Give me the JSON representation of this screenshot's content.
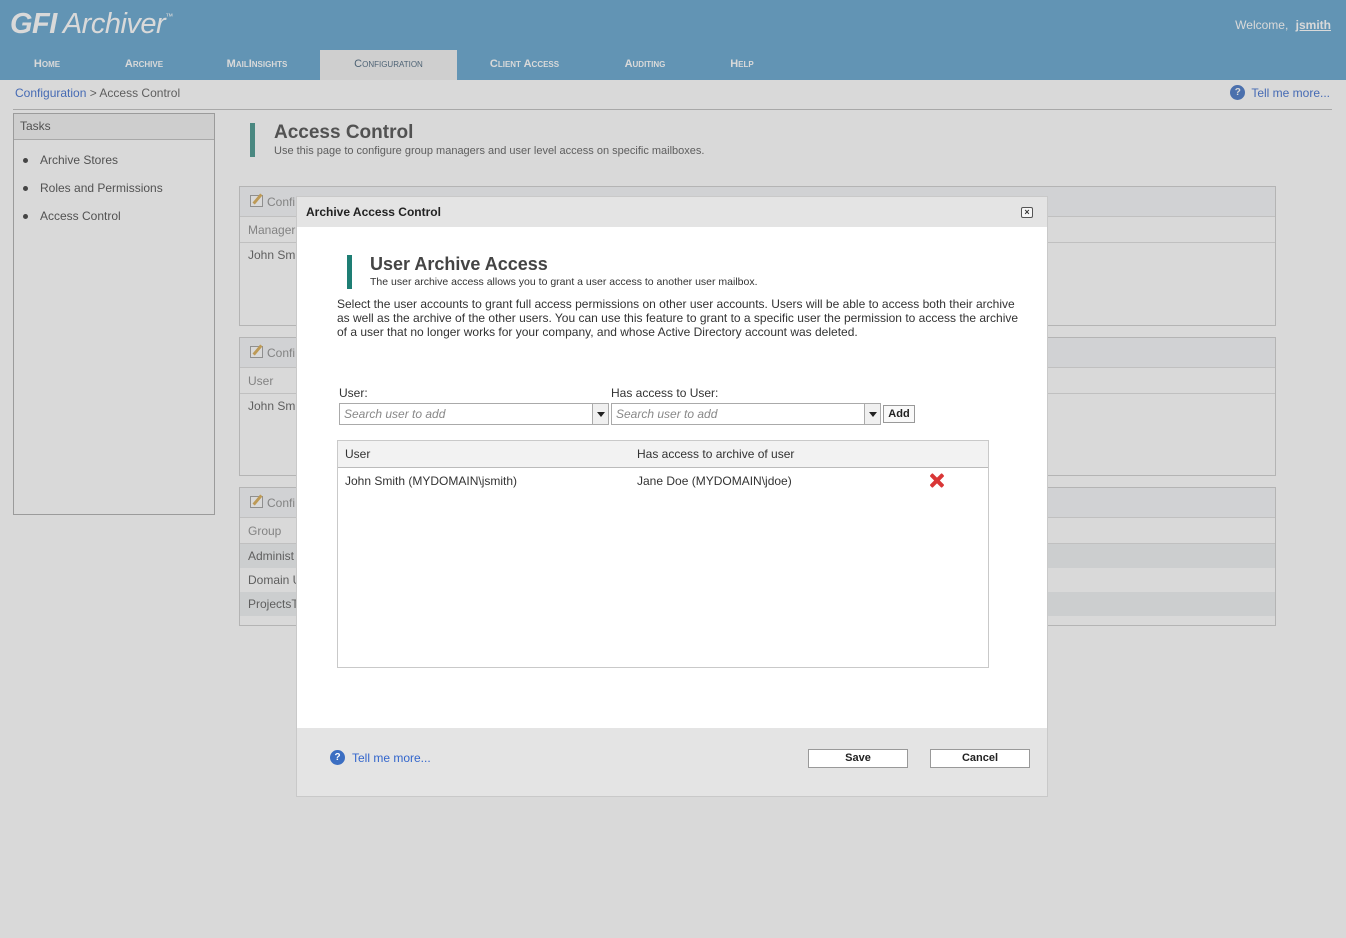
{
  "app": {
    "logo_bold": "GFI",
    "logo_text": "Archiver",
    "logo_tm": "™",
    "welcome_label": "Welcome,",
    "username": "jsmith"
  },
  "nav": {
    "items": [
      {
        "label": "Home"
      },
      {
        "label": "Archive"
      },
      {
        "label": "MailInsights"
      },
      {
        "label": "Configuration"
      },
      {
        "label": "Client Access"
      },
      {
        "label": "Auditing"
      },
      {
        "label": "Help"
      }
    ],
    "active": "Configuration"
  },
  "breadcrumb": {
    "root": "Configuration",
    "sep": ">",
    "current": "Access Control"
  },
  "help": {
    "label": "Tell me more..."
  },
  "tasks": {
    "title": "Tasks",
    "items": [
      "Archive Stores",
      "Roles and Permissions",
      "Access Control"
    ]
  },
  "page": {
    "title": "Access Control",
    "subtitle": "Use this page to configure group managers and user level access on specific mailboxes."
  },
  "panels": [
    {
      "head": "Confi",
      "col": "Manager",
      "rows": [
        "John Smi"
      ]
    },
    {
      "head": "Confi",
      "col": "User",
      "rows": [
        "John Smi"
      ]
    },
    {
      "head": "Confi",
      "col": "Group",
      "rows": [
        "Administ",
        "Domain U",
        "ProjectsT"
      ]
    }
  ],
  "dialog": {
    "title": "Archive Access Control",
    "close_glyph": "×",
    "section_title": "User Archive Access",
    "section_sub": "The user archive access allows you to grant a user access to another user mailbox.",
    "description": "Select the user accounts to grant full access permissions on other user accounts. Users will be able to access both their archive as well as the archive of the other users. You can use this feature to grant to a specific user the permission to access the archive of a user that no longer works for your company, and whose Active Directory account was deleted.",
    "user_label": "User:",
    "has_access_label": "Has access to User:",
    "user_placeholder": "Search user to add",
    "has_access_placeholder": "Search user to add",
    "add_label": "Add",
    "grid": {
      "col_user": "User",
      "col_access": "Has access to archive of user",
      "rows": [
        {
          "user": "John Smith (MYDOMAIN\\jsmith)",
          "access": "Jane Doe (MYDOMAIN\\jdoe)"
        }
      ]
    },
    "help_label": "Tell me more...",
    "save_label": "Save",
    "cancel_label": "Cancel"
  }
}
